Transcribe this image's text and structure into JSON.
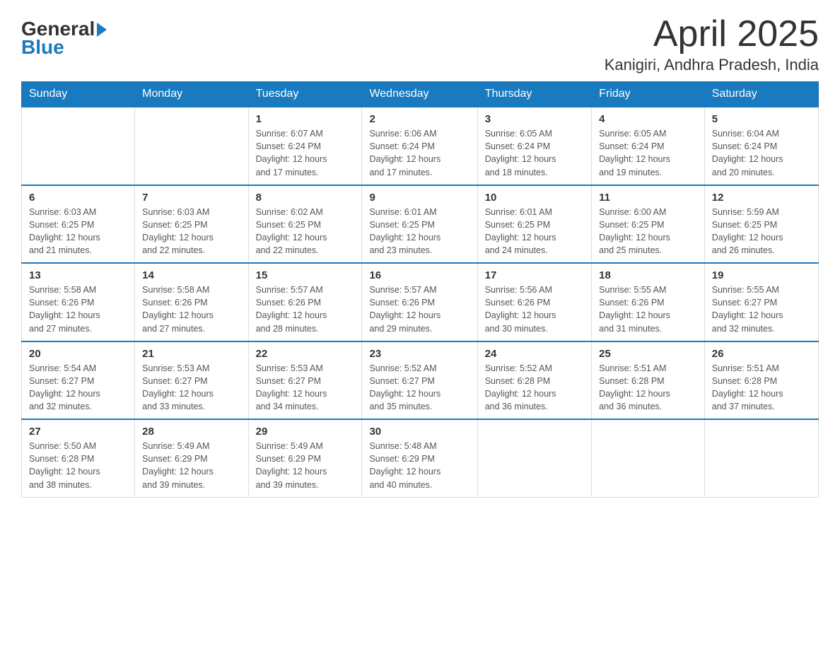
{
  "header": {
    "logo_general": "General",
    "logo_blue": "Blue",
    "month": "April 2025",
    "location": "Kanigiri, Andhra Pradesh, India"
  },
  "days_of_week": [
    "Sunday",
    "Monday",
    "Tuesday",
    "Wednesday",
    "Thursday",
    "Friday",
    "Saturday"
  ],
  "weeks": [
    [
      {
        "day": "",
        "info": ""
      },
      {
        "day": "",
        "info": ""
      },
      {
        "day": "1",
        "info": "Sunrise: 6:07 AM\nSunset: 6:24 PM\nDaylight: 12 hours\nand 17 minutes."
      },
      {
        "day": "2",
        "info": "Sunrise: 6:06 AM\nSunset: 6:24 PM\nDaylight: 12 hours\nand 17 minutes."
      },
      {
        "day": "3",
        "info": "Sunrise: 6:05 AM\nSunset: 6:24 PM\nDaylight: 12 hours\nand 18 minutes."
      },
      {
        "day": "4",
        "info": "Sunrise: 6:05 AM\nSunset: 6:24 PM\nDaylight: 12 hours\nand 19 minutes."
      },
      {
        "day": "5",
        "info": "Sunrise: 6:04 AM\nSunset: 6:24 PM\nDaylight: 12 hours\nand 20 minutes."
      }
    ],
    [
      {
        "day": "6",
        "info": "Sunrise: 6:03 AM\nSunset: 6:25 PM\nDaylight: 12 hours\nand 21 minutes."
      },
      {
        "day": "7",
        "info": "Sunrise: 6:03 AM\nSunset: 6:25 PM\nDaylight: 12 hours\nand 22 minutes."
      },
      {
        "day": "8",
        "info": "Sunrise: 6:02 AM\nSunset: 6:25 PM\nDaylight: 12 hours\nand 22 minutes."
      },
      {
        "day": "9",
        "info": "Sunrise: 6:01 AM\nSunset: 6:25 PM\nDaylight: 12 hours\nand 23 minutes."
      },
      {
        "day": "10",
        "info": "Sunrise: 6:01 AM\nSunset: 6:25 PM\nDaylight: 12 hours\nand 24 minutes."
      },
      {
        "day": "11",
        "info": "Sunrise: 6:00 AM\nSunset: 6:25 PM\nDaylight: 12 hours\nand 25 minutes."
      },
      {
        "day": "12",
        "info": "Sunrise: 5:59 AM\nSunset: 6:25 PM\nDaylight: 12 hours\nand 26 minutes."
      }
    ],
    [
      {
        "day": "13",
        "info": "Sunrise: 5:58 AM\nSunset: 6:26 PM\nDaylight: 12 hours\nand 27 minutes."
      },
      {
        "day": "14",
        "info": "Sunrise: 5:58 AM\nSunset: 6:26 PM\nDaylight: 12 hours\nand 27 minutes."
      },
      {
        "day": "15",
        "info": "Sunrise: 5:57 AM\nSunset: 6:26 PM\nDaylight: 12 hours\nand 28 minutes."
      },
      {
        "day": "16",
        "info": "Sunrise: 5:57 AM\nSunset: 6:26 PM\nDaylight: 12 hours\nand 29 minutes."
      },
      {
        "day": "17",
        "info": "Sunrise: 5:56 AM\nSunset: 6:26 PM\nDaylight: 12 hours\nand 30 minutes."
      },
      {
        "day": "18",
        "info": "Sunrise: 5:55 AM\nSunset: 6:26 PM\nDaylight: 12 hours\nand 31 minutes."
      },
      {
        "day": "19",
        "info": "Sunrise: 5:55 AM\nSunset: 6:27 PM\nDaylight: 12 hours\nand 32 minutes."
      }
    ],
    [
      {
        "day": "20",
        "info": "Sunrise: 5:54 AM\nSunset: 6:27 PM\nDaylight: 12 hours\nand 32 minutes."
      },
      {
        "day": "21",
        "info": "Sunrise: 5:53 AM\nSunset: 6:27 PM\nDaylight: 12 hours\nand 33 minutes."
      },
      {
        "day": "22",
        "info": "Sunrise: 5:53 AM\nSunset: 6:27 PM\nDaylight: 12 hours\nand 34 minutes."
      },
      {
        "day": "23",
        "info": "Sunrise: 5:52 AM\nSunset: 6:27 PM\nDaylight: 12 hours\nand 35 minutes."
      },
      {
        "day": "24",
        "info": "Sunrise: 5:52 AM\nSunset: 6:28 PM\nDaylight: 12 hours\nand 36 minutes."
      },
      {
        "day": "25",
        "info": "Sunrise: 5:51 AM\nSunset: 6:28 PM\nDaylight: 12 hours\nand 36 minutes."
      },
      {
        "day": "26",
        "info": "Sunrise: 5:51 AM\nSunset: 6:28 PM\nDaylight: 12 hours\nand 37 minutes."
      }
    ],
    [
      {
        "day": "27",
        "info": "Sunrise: 5:50 AM\nSunset: 6:28 PM\nDaylight: 12 hours\nand 38 minutes."
      },
      {
        "day": "28",
        "info": "Sunrise: 5:49 AM\nSunset: 6:29 PM\nDaylight: 12 hours\nand 39 minutes."
      },
      {
        "day": "29",
        "info": "Sunrise: 5:49 AM\nSunset: 6:29 PM\nDaylight: 12 hours\nand 39 minutes."
      },
      {
        "day": "30",
        "info": "Sunrise: 5:48 AM\nSunset: 6:29 PM\nDaylight: 12 hours\nand 40 minutes."
      },
      {
        "day": "",
        "info": ""
      },
      {
        "day": "",
        "info": ""
      },
      {
        "day": "",
        "info": ""
      }
    ]
  ]
}
